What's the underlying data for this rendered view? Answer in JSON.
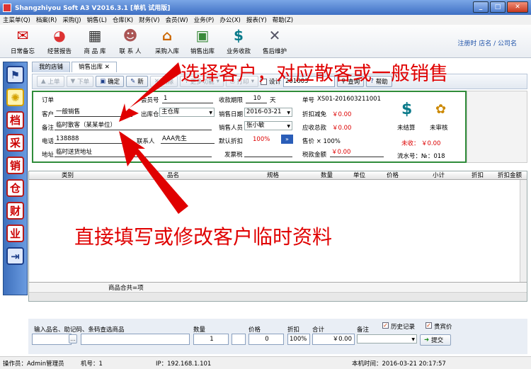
{
  "window": {
    "title": "Shangzhiyou Soft A3 V2016.3.1 [单机 试用版]"
  },
  "menu": [
    "主菜单(Q)",
    "档案(R)",
    "采购(J)",
    "销售(L)",
    "仓库(K)",
    "财务(V)",
    "会员(W)",
    "业务(P)",
    "办公(X)",
    "报表(Y)",
    "帮助(Z)"
  ],
  "toolbar": {
    "items": [
      "日常备忘",
      "经营报告",
      "商 品 库",
      "联 系 人",
      "采购入库",
      "销售出库",
      "业务收款",
      "售后维护"
    ],
    "links": "注册时 店名 / 公司名"
  },
  "left_icons": [
    "档",
    "采",
    "销",
    "仓",
    "财",
    "业"
  ],
  "tabs": [
    "我的店铺",
    "销售出库"
  ],
  "tab_close": "✕",
  "subbar": {
    "prev": "上单",
    "next": "下单",
    "confirm": "确定",
    "new": "新",
    "delete": "删除",
    "more": "更多功能",
    "print": "打印",
    "design": "设计",
    "period": "201603",
    "query": "查询",
    "help": "帮助"
  },
  "form": {
    "order_label": "订单",
    "member_label": "会员号",
    "member_value": "1",
    "period_label": "收款期限",
    "period_value": "10",
    "period_unit": "天",
    "no_label": "单号",
    "no_value": "XS01-201603211001",
    "customer_label": "客户",
    "customer_value": "一般销售",
    "warehouse_label": "出库仓",
    "warehouse_value": "主仓库",
    "date_label": "销售日期",
    "date_value": "2016-03-21",
    "discount_label": "折扣减免",
    "discount_value": "￥0.00",
    "note_label": "备注",
    "note_value": "临时散客（某某单位）",
    "seller_label": "销售人员",
    "seller_value": "张小敏",
    "due_label": "应收总款",
    "due_value": "￥0.00",
    "phone_label": "电话",
    "phone_value": "138888",
    "contact_label": "联系人",
    "contact_value": "AAA先生",
    "default_discount_label": "默认折扣",
    "default_discount_value": "100%",
    "price_label": "售价 × 100%",
    "addr_label": "地址",
    "addr_value": "临时送货地址",
    "tax_label": "发票税",
    "tax_total_label": "税款金额",
    "tax_total_value": "￥0.00"
  },
  "right": {
    "unsettled": "未结算",
    "unaudited": "未审核",
    "unpaid": "未收：",
    "unpaid_value": "￥0.00",
    "serial": "流水号：№：018"
  },
  "grid": {
    "headers": [
      "类别",
      "品名",
      "规格",
      "数量",
      "单位",
      "价格",
      "小计",
      "折扣",
      "折扣金额"
    ],
    "summary": "商品合共=项"
  },
  "entry": {
    "search_label": "输入品名、助记码、条码查选商品",
    "qty_label": "数量",
    "qty_value": "1",
    "price_label": "价格",
    "price_value": "0",
    "discount_label": "折扣",
    "discount_value": "100%",
    "total_label": "合计",
    "total_value": "￥0.00",
    "note_label": "备注",
    "history_label": "历史记录",
    "vip_label": "贵宾价",
    "submit": "提交"
  },
  "status": {
    "operator": "操作员：Admin管理员",
    "machine": "机号：1",
    "ip": "IP：192.168.1.101",
    "time": "本机时间：2016-03-21 20:17:57"
  },
  "annotations": {
    "top": "选择客户，对应散客或一般销售",
    "bottom": "直接填写或修改客户临时资料"
  }
}
